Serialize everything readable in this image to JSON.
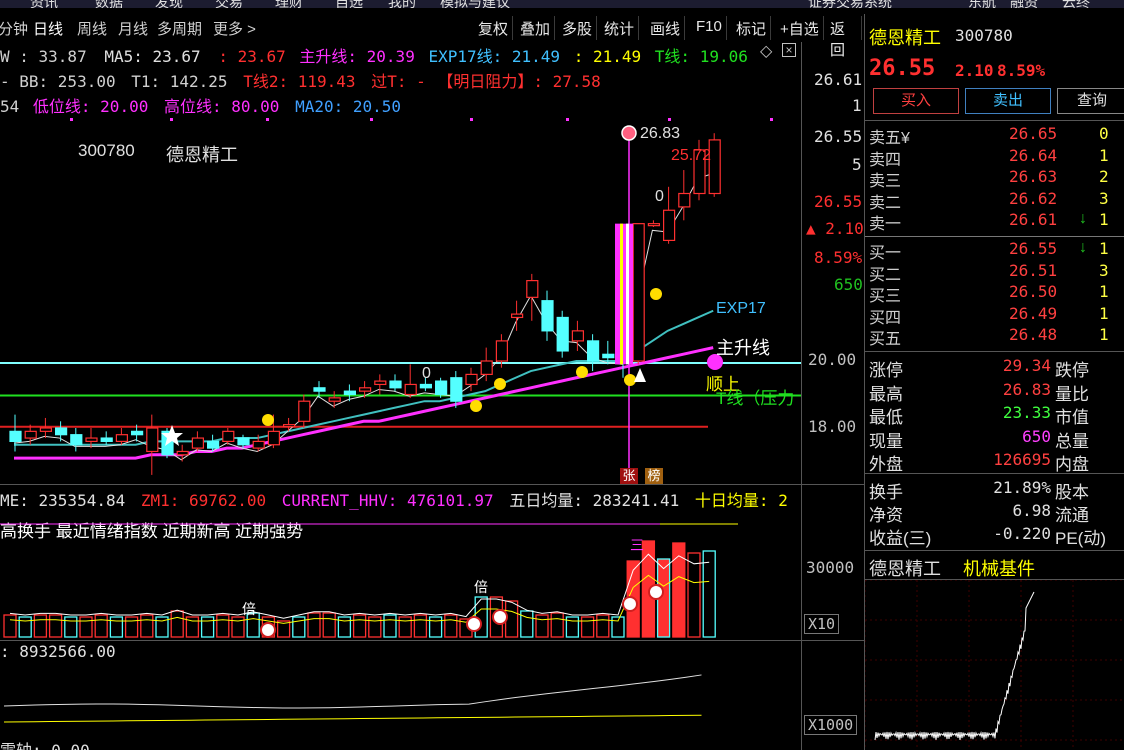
{
  "top_menu": [
    "资讯",
    "数据",
    "发现",
    "交易",
    "理财",
    "自选",
    "我的",
    "模拟与建议",
    "证券交易系统",
    "东航",
    "融资",
    "云终"
  ],
  "period_bar": {
    "items": [
      "分钟",
      "日线",
      "周线",
      "月线",
      "多周期",
      "更多 >"
    ],
    "active": "日线"
  },
  "toolbar": [
    "复权",
    "叠加",
    "多股",
    "统计",
    "画线",
    "F10",
    "标记",
    "+自选",
    "返回"
  ],
  "indicator_lines": {
    "line1": {
      "w": "W : 33.87",
      "ma5": "MA5: 23.67",
      "v1": ": 23.67",
      "zsx": "主升线: 20.39",
      "exp17": "EXP17线: 21.49",
      "v2": ": 21.49",
      "t": "T线: 19.06"
    },
    "line2": {
      "bb": "- BB: 253.00",
      "t1": "T1: 142.25",
      "t2": "T线2: 119.43",
      "guot": "过T: -",
      "mrzl": "【明日阻力】: 27.58"
    },
    "line3": {
      "p": "54",
      "dwx": "低位线: 20.00",
      "gwx": "高位线: 80.00",
      "ma20": "MA20: 20.50"
    }
  },
  "stock": {
    "code": "300780",
    "name": "德恩精工",
    "price": "26.55",
    "change": "2.10",
    "change_pct": "8.59%",
    "industry": "机械基件"
  },
  "chart_labels": {
    "high_marker": "26.83",
    "high_price": "25.72",
    "zero_a": "0",
    "zero_b": "0",
    "exp17": "EXP17",
    "zsx": "主升线",
    "shunshang": "顺上",
    "tline": "T线（压力",
    "zhang": "张",
    "bang": "榜",
    "bei1": "倍",
    "bei2": "倍",
    "san": "三"
  },
  "price_axis": [
    "26.61",
    "1",
    "26.55",
    "5",
    "26.55",
    "▲ 2.10",
    "8.59%",
    "650",
    "20.00",
    "18.00"
  ],
  "volume_header": {
    "me": "ME: 235354.84",
    "zm1": "ZM1: 69762.00",
    "hhv": "CURRENT_HHV: 476101.97",
    "wr": "五日均量: 283241.41",
    "sr": "十日均量: 2"
  },
  "volume_tabs": "高换手  最近情绪指数  近期新高  近期强势",
  "volume_axis": [
    "30000",
    "X10"
  ],
  "lower_header": ": 8932566.00",
  "lower_axis": [
    "X1000"
  ],
  "bottom_text": "需轴: 0.00",
  "buttons": {
    "buy": "买入",
    "sell": "卖出",
    "query": "查询"
  },
  "order_book": {
    "sell": [
      {
        "label": "卖五",
        "mark": "¥",
        "price": "26.65",
        "vol": "0"
      },
      {
        "label": "卖四",
        "mark": "",
        "price": "26.64",
        "vol": "1"
      },
      {
        "label": "卖三",
        "mark": "",
        "price": "26.63",
        "vol": "2"
      },
      {
        "label": "卖二",
        "mark": "",
        "price": "26.62",
        "vol": "3"
      },
      {
        "label": "卖一",
        "mark": "↓",
        "price": "26.61",
        "vol": "1"
      }
    ],
    "buy": [
      {
        "label": "买一",
        "mark": "↓",
        "price": "26.55",
        "vol": "1"
      },
      {
        "label": "买二",
        "mark": "",
        "price": "26.51",
        "vol": "3"
      },
      {
        "label": "买三",
        "mark": "",
        "price": "26.50",
        "vol": "1"
      },
      {
        "label": "买四",
        "mark": "",
        "price": "26.49",
        "vol": "1"
      },
      {
        "label": "买五",
        "mark": "",
        "price": "26.48",
        "vol": "1"
      }
    ]
  },
  "stats": [
    {
      "l1": "涨停",
      "v1": "29.34",
      "c1": "#ff4040",
      "l2": "跌停"
    },
    {
      "l1": "最高",
      "v1": "26.83",
      "c1": "#ff4040",
      "l2": "量比"
    },
    {
      "l1": "最低",
      "v1": "23.33",
      "c1": "#40ff40",
      "l2": "市值"
    },
    {
      "l1": "现量",
      "v1": "650",
      "c1": "#ff40ff",
      "l2": "总量"
    },
    {
      "l1": "外盘",
      "v1": "126695",
      "c1": "#ff4040",
      "l2": "内盘"
    }
  ],
  "stats2": [
    {
      "l1": "换手",
      "v1": "21.89%",
      "l2": "股本"
    },
    {
      "l1": "净资",
      "v1": "6.98",
      "l2": "流通"
    },
    {
      "l1": "收益(三)",
      "v1": "-0.220",
      "l2": "PE(动)"
    }
  ],
  "colors": {
    "up": "#ff3030",
    "down": "#54ffff",
    "ma_white": "#ffffff",
    "ma_yellow": "#ffff00",
    "ma_magenta": "#ff30ff",
    "ma_green": "#00ff00",
    "ma_teal": "#40c0c0",
    "tline_green": "#20e020",
    "cyan_line": "#80ffff"
  },
  "chart_data": {
    "type": "candlestick",
    "title": "300780 德恩精工",
    "ylim": [
      16.5,
      27.2
    ],
    "candles": [
      {
        "o": 17.9,
        "c": 17.6,
        "h": 18.4,
        "l": 17.3
      },
      {
        "o": 17.7,
        "c": 17.9,
        "h": 18.1,
        "l": 17.5
      },
      {
        "o": 17.9,
        "c": 18.0,
        "h": 18.3,
        "l": 17.7
      },
      {
        "o": 18.0,
        "c": 17.8,
        "h": 18.2,
        "l": 17.6
      },
      {
        "o": 17.8,
        "c": 17.5,
        "h": 18.0,
        "l": 17.3
      },
      {
        "o": 17.6,
        "c": 17.7,
        "h": 18.0,
        "l": 17.4
      },
      {
        "o": 17.7,
        "c": 17.6,
        "h": 17.9,
        "l": 17.5
      },
      {
        "o": 17.6,
        "c": 17.8,
        "h": 18.0,
        "l": 17.5
      },
      {
        "o": 17.9,
        "c": 17.8,
        "h": 18.1,
        "l": 17.6
      },
      {
        "o": 17.3,
        "c": 18.0,
        "h": 18.4,
        "l": 16.6
      },
      {
        "o": 17.9,
        "c": 17.2,
        "h": 18.0,
        "l": 17.1
      },
      {
        "o": 17.2,
        "c": 17.3,
        "h": 17.5,
        "l": 17.0
      },
      {
        "o": 17.4,
        "c": 17.7,
        "h": 17.9,
        "l": 17.3
      },
      {
        "o": 17.6,
        "c": 17.4,
        "h": 17.8,
        "l": 17.3
      },
      {
        "o": 17.6,
        "c": 17.9,
        "h": 18.0,
        "l": 17.5
      },
      {
        "o": 17.7,
        "c": 17.5,
        "h": 17.8,
        "l": 17.4
      },
      {
        "o": 17.4,
        "c": 17.6,
        "h": 17.8,
        "l": 17.3
      },
      {
        "o": 17.5,
        "c": 17.9,
        "h": 18.4,
        "l": 17.4
      },
      {
        "o": 18.1,
        "c": 18.1,
        "h": 18.3,
        "l": 17.9
      },
      {
        "o": 18.2,
        "c": 18.8,
        "h": 19.0,
        "l": 18.0
      },
      {
        "o": 19.2,
        "c": 19.1,
        "h": 19.4,
        "l": 18.9
      },
      {
        "o": 18.8,
        "c": 18.9,
        "h": 19.1,
        "l": 18.6
      },
      {
        "o": 19.1,
        "c": 19.0,
        "h": 19.3,
        "l": 18.8
      },
      {
        "o": 19.1,
        "c": 19.2,
        "h": 19.4,
        "l": 18.9
      },
      {
        "o": 19.3,
        "c": 19.4,
        "h": 19.6,
        "l": 19.0
      },
      {
        "o": 19.4,
        "c": 19.2,
        "h": 19.6,
        "l": 19.1
      },
      {
        "o": 19.0,
        "c": 19.3,
        "h": 19.9,
        "l": 18.9
      },
      {
        "o": 19.3,
        "c": 19.2,
        "h": 19.5,
        "l": 19.1
      },
      {
        "o": 19.4,
        "c": 19.0,
        "h": 19.5,
        "l": 18.9
      },
      {
        "o": 19.5,
        "c": 18.8,
        "h": 19.7,
        "l": 18.6
      },
      {
        "o": 19.3,
        "c": 19.6,
        "h": 19.8,
        "l": 19.1
      },
      {
        "o": 19.6,
        "c": 20.0,
        "h": 20.4,
        "l": 19.4
      },
      {
        "o": 20.0,
        "c": 20.6,
        "h": 20.8,
        "l": 19.8
      },
      {
        "o": 21.3,
        "c": 21.4,
        "h": 21.8,
        "l": 20.9
      },
      {
        "o": 21.9,
        "c": 22.4,
        "h": 22.6,
        "l": 21.2
      },
      {
        "o": 21.8,
        "c": 20.9,
        "h": 22.1,
        "l": 20.6
      },
      {
        "o": 21.3,
        "c": 20.3,
        "h": 21.5,
        "l": 20.1
      },
      {
        "o": 20.6,
        "c": 20.9,
        "h": 21.2,
        "l": 20.3
      },
      {
        "o": 20.6,
        "c": 20.0,
        "h": 20.8,
        "l": 19.7
      },
      {
        "o": 20.2,
        "c": 20.1,
        "h": 20.6,
        "l": 19.9
      },
      {
        "o": 20.2,
        "c": 20.0,
        "h": 21.0,
        "l": 19.5
      },
      {
        "o": 20.0,
        "c": 24.1,
        "h": 24.1,
        "l": 19.9
      },
      {
        "o": 24.1,
        "c": 24.1,
        "h": 24.2,
        "l": 24.0
      },
      {
        "o": 23.6,
        "c": 24.5,
        "h": 25.2,
        "l": 23.5
      },
      {
        "o": 24.6,
        "c": 25.0,
        "h": 25.7,
        "l": 24.2
      },
      {
        "o": 25.0,
        "c": 26.3,
        "h": 26.6,
        "l": 24.8
      },
      {
        "o": 25.0,
        "c": 26.6,
        "h": 26.8,
        "l": 24.9
      }
    ],
    "series": [
      {
        "name": "主升线",
        "color": "#ff30ff",
        "values": [
          17.1,
          17.1,
          17.1,
          17.1,
          17.1,
          17.1,
          17.1,
          17.1,
          17.1,
          17.2,
          17.2,
          17.2,
          17.3,
          17.3,
          17.4,
          17.4,
          17.5,
          17.6,
          17.7,
          17.8,
          17.9,
          18.0,
          18.1,
          18.2,
          18.2,
          18.3,
          18.4,
          18.5,
          18.6,
          18.7,
          18.8,
          18.9,
          19.0,
          19.1,
          19.2,
          19.3,
          19.4,
          19.5,
          19.6,
          19.7,
          19.8,
          19.9,
          20.0,
          20.1,
          20.2,
          20.3,
          20.4
        ]
      },
      {
        "name": "EXP17",
        "color": "#40c0c0",
        "values": [
          17.5,
          17.5,
          17.5,
          17.5,
          17.5,
          17.5,
          17.5,
          17.5,
          17.5,
          17.6,
          17.6,
          17.6,
          17.6,
          17.6,
          17.7,
          17.7,
          17.7,
          17.8,
          17.9,
          18.0,
          18.1,
          18.2,
          18.3,
          18.4,
          18.5,
          18.6,
          18.7,
          18.8,
          18.8,
          18.9,
          19.0,
          19.1,
          19.3,
          19.5,
          19.7,
          19.8,
          19.9,
          20.0,
          20.0,
          20.0,
          20.0,
          20.3,
          20.6,
          20.9,
          21.1,
          21.3,
          21.5
        ]
      }
    ]
  }
}
